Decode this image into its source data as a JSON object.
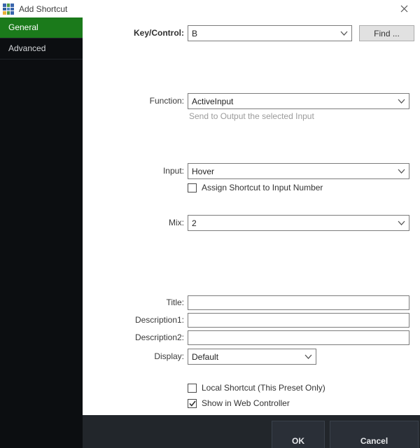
{
  "window": {
    "title": "Add Shortcut"
  },
  "sidebar": {
    "items": [
      "General",
      "Advanced"
    ],
    "selected": "General"
  },
  "form": {
    "key_control": {
      "label": "Key/Control:",
      "value": "B"
    },
    "find_button": "Find ...",
    "function": {
      "label": "Function:",
      "value": "ActiveInput",
      "description": "Send to Output the selected Input"
    },
    "input": {
      "label": "Input:",
      "value": "Hover"
    },
    "assign_shortcut": {
      "label": "Assign Shortcut to Input Number",
      "checked": false
    },
    "mix": {
      "label": "Mix:",
      "value": "2"
    },
    "title": {
      "label": "Title:",
      "value": ""
    },
    "description1": {
      "label": "Description1:",
      "value": ""
    },
    "description2": {
      "label": "Description2:",
      "value": ""
    },
    "display": {
      "label": "Display:",
      "value": "Default"
    },
    "local_shortcut": {
      "label": "Local Shortcut (This Preset Only)",
      "checked": false
    },
    "web_controller": {
      "label": "Show in Web Controller",
      "checked": true
    }
  },
  "footer": {
    "ok": "OK",
    "cancel": "Cancel"
  },
  "colors": {
    "selected_green": "#1b7a1b",
    "sidebar_bg": "#0c0e11",
    "footer_bg": "#22262b",
    "button_bg": "#2a2f37"
  }
}
